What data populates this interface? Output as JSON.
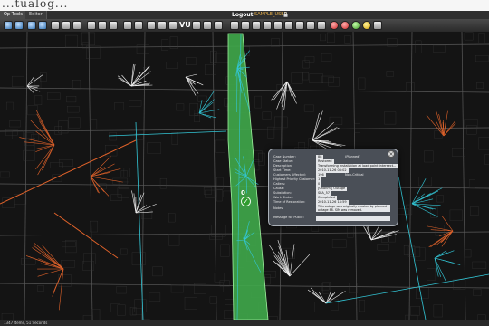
{
  "brand": {
    "text": "...tualog..."
  },
  "tabs": [
    "Op Tools",
    "Editor"
  ],
  "header": {
    "logout": "Logout",
    "username": "SAMPLE_USER"
  },
  "toolbar": {
    "vu_label": "VU"
  },
  "map": {
    "outage_count": "0"
  },
  "popup": {
    "fields": [
      {
        "label": "Case Number:",
        "value": "88",
        "extra": "(Planned)"
      },
      {
        "label": "Case Status:",
        "value": "Restored"
      },
      {
        "label": "Description:",
        "value": "Transforming installation at load point intersect..."
      },
      {
        "label": "Start Time:",
        "value": "2010-11-26 08:02"
      },
      {
        "label": "Customers Affected:",
        "value": "196",
        "extra": "Non-Critical"
      },
      {
        "label": "Highest Priority Customer:",
        "value": "1"
      },
      {
        "label": "Callers:",
        "value": "0"
      },
      {
        "label": "Cause:",
        "value": "[Chonmi] Outage"
      },
      {
        "label": "Substation:",
        "value": "SEA_57"
      },
      {
        "label": "Work Status:",
        "value": "Completed"
      },
      {
        "label": "Time of Restoration:",
        "value": "2010-11-26 14:59"
      }
    ],
    "notes_label": "Notes:",
    "notes_value": "This outage was originally created by planned outage 88. SIM was removed.",
    "message_label": "Message for Public:"
  },
  "footer": {
    "text": "1347 Items, 51 Seconds"
  },
  "colors": {
    "outage_polygon": "#3fa84a",
    "feeder_orange": "#e0622a",
    "feeder_cyan": "#33c6d6",
    "feeder_white": "#f1f1f1",
    "street_grid": "#5a5a5a"
  }
}
